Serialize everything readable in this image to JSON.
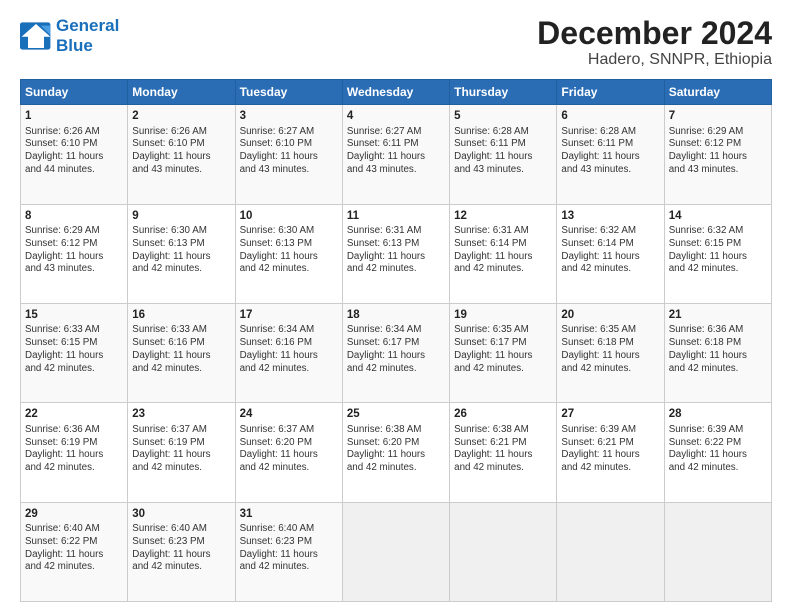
{
  "logo": {
    "line1": "General",
    "line2": "Blue"
  },
  "title": "December 2024",
  "subtitle": "Hadero, SNNPR, Ethiopia",
  "days_header": [
    "Sunday",
    "Monday",
    "Tuesday",
    "Wednesday",
    "Thursday",
    "Friday",
    "Saturday"
  ],
  "weeks": [
    [
      {
        "day": "1",
        "info": "Sunrise: 6:26 AM\nSunset: 6:10 PM\nDaylight: 11 hours\nand 44 minutes."
      },
      {
        "day": "2",
        "info": "Sunrise: 6:26 AM\nSunset: 6:10 PM\nDaylight: 11 hours\nand 43 minutes."
      },
      {
        "day": "3",
        "info": "Sunrise: 6:27 AM\nSunset: 6:10 PM\nDaylight: 11 hours\nand 43 minutes."
      },
      {
        "day": "4",
        "info": "Sunrise: 6:27 AM\nSunset: 6:11 PM\nDaylight: 11 hours\nand 43 minutes."
      },
      {
        "day": "5",
        "info": "Sunrise: 6:28 AM\nSunset: 6:11 PM\nDaylight: 11 hours\nand 43 minutes."
      },
      {
        "day": "6",
        "info": "Sunrise: 6:28 AM\nSunset: 6:11 PM\nDaylight: 11 hours\nand 43 minutes."
      },
      {
        "day": "7",
        "info": "Sunrise: 6:29 AM\nSunset: 6:12 PM\nDaylight: 11 hours\nand 43 minutes."
      }
    ],
    [
      {
        "day": "8",
        "info": "Sunrise: 6:29 AM\nSunset: 6:12 PM\nDaylight: 11 hours\nand 43 minutes."
      },
      {
        "day": "9",
        "info": "Sunrise: 6:30 AM\nSunset: 6:13 PM\nDaylight: 11 hours\nand 42 minutes."
      },
      {
        "day": "10",
        "info": "Sunrise: 6:30 AM\nSunset: 6:13 PM\nDaylight: 11 hours\nand 42 minutes."
      },
      {
        "day": "11",
        "info": "Sunrise: 6:31 AM\nSunset: 6:13 PM\nDaylight: 11 hours\nand 42 minutes."
      },
      {
        "day": "12",
        "info": "Sunrise: 6:31 AM\nSunset: 6:14 PM\nDaylight: 11 hours\nand 42 minutes."
      },
      {
        "day": "13",
        "info": "Sunrise: 6:32 AM\nSunset: 6:14 PM\nDaylight: 11 hours\nand 42 minutes."
      },
      {
        "day": "14",
        "info": "Sunrise: 6:32 AM\nSunset: 6:15 PM\nDaylight: 11 hours\nand 42 minutes."
      }
    ],
    [
      {
        "day": "15",
        "info": "Sunrise: 6:33 AM\nSunset: 6:15 PM\nDaylight: 11 hours\nand 42 minutes."
      },
      {
        "day": "16",
        "info": "Sunrise: 6:33 AM\nSunset: 6:16 PM\nDaylight: 11 hours\nand 42 minutes."
      },
      {
        "day": "17",
        "info": "Sunrise: 6:34 AM\nSunset: 6:16 PM\nDaylight: 11 hours\nand 42 minutes."
      },
      {
        "day": "18",
        "info": "Sunrise: 6:34 AM\nSunset: 6:17 PM\nDaylight: 11 hours\nand 42 minutes."
      },
      {
        "day": "19",
        "info": "Sunrise: 6:35 AM\nSunset: 6:17 PM\nDaylight: 11 hours\nand 42 minutes."
      },
      {
        "day": "20",
        "info": "Sunrise: 6:35 AM\nSunset: 6:18 PM\nDaylight: 11 hours\nand 42 minutes."
      },
      {
        "day": "21",
        "info": "Sunrise: 6:36 AM\nSunset: 6:18 PM\nDaylight: 11 hours\nand 42 minutes."
      }
    ],
    [
      {
        "day": "22",
        "info": "Sunrise: 6:36 AM\nSunset: 6:19 PM\nDaylight: 11 hours\nand 42 minutes."
      },
      {
        "day": "23",
        "info": "Sunrise: 6:37 AM\nSunset: 6:19 PM\nDaylight: 11 hours\nand 42 minutes."
      },
      {
        "day": "24",
        "info": "Sunrise: 6:37 AM\nSunset: 6:20 PM\nDaylight: 11 hours\nand 42 minutes."
      },
      {
        "day": "25",
        "info": "Sunrise: 6:38 AM\nSunset: 6:20 PM\nDaylight: 11 hours\nand 42 minutes."
      },
      {
        "day": "26",
        "info": "Sunrise: 6:38 AM\nSunset: 6:21 PM\nDaylight: 11 hours\nand 42 minutes."
      },
      {
        "day": "27",
        "info": "Sunrise: 6:39 AM\nSunset: 6:21 PM\nDaylight: 11 hours\nand 42 minutes."
      },
      {
        "day": "28",
        "info": "Sunrise: 6:39 AM\nSunset: 6:22 PM\nDaylight: 11 hours\nand 42 minutes."
      }
    ],
    [
      {
        "day": "29",
        "info": "Sunrise: 6:40 AM\nSunset: 6:22 PM\nDaylight: 11 hours\nand 42 minutes."
      },
      {
        "day": "30",
        "info": "Sunrise: 6:40 AM\nSunset: 6:23 PM\nDaylight: 11 hours\nand 42 minutes."
      },
      {
        "day": "31",
        "info": "Sunrise: 6:40 AM\nSunset: 6:23 PM\nDaylight: 11 hours\nand 42 minutes."
      },
      null,
      null,
      null,
      null
    ]
  ]
}
